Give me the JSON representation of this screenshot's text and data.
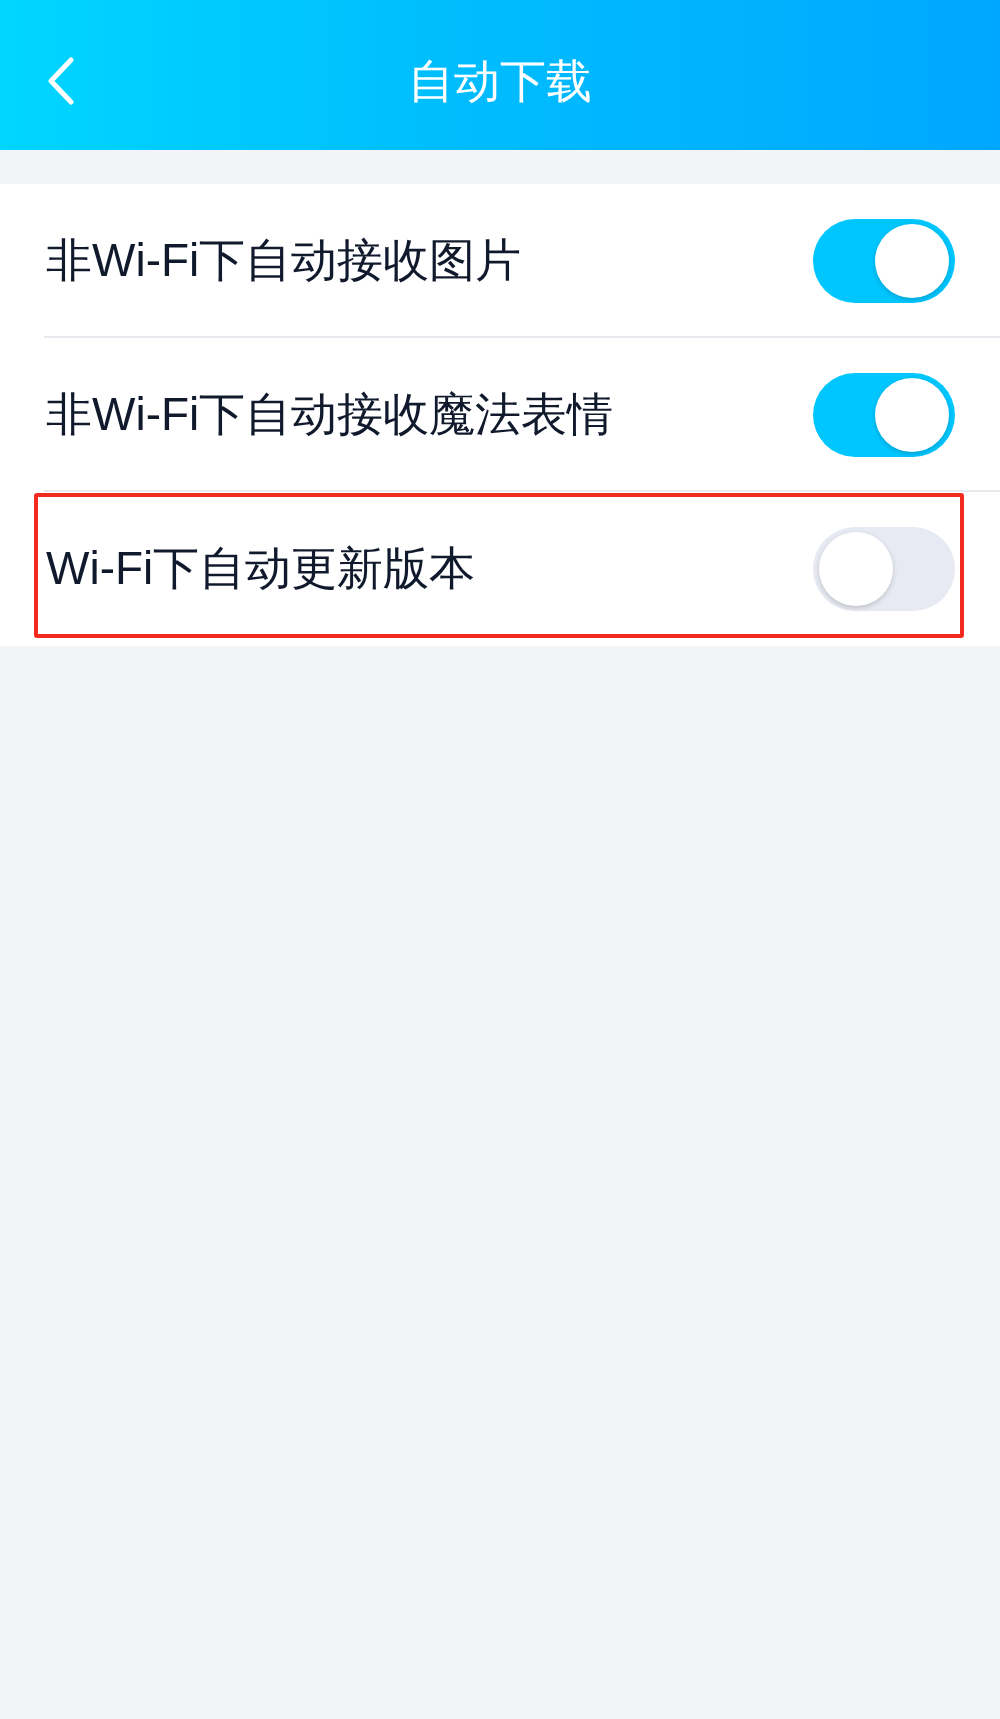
{
  "header": {
    "title": "自动下载"
  },
  "items": [
    {
      "label": "非Wi-Fi下自动接收图片",
      "on": true,
      "highlighted": false
    },
    {
      "label": "非Wi-Fi下自动接收魔法表情",
      "on": true,
      "highlighted": false
    },
    {
      "label": "Wi-Fi下自动更新版本",
      "on": false,
      "highlighted": true
    }
  ]
}
